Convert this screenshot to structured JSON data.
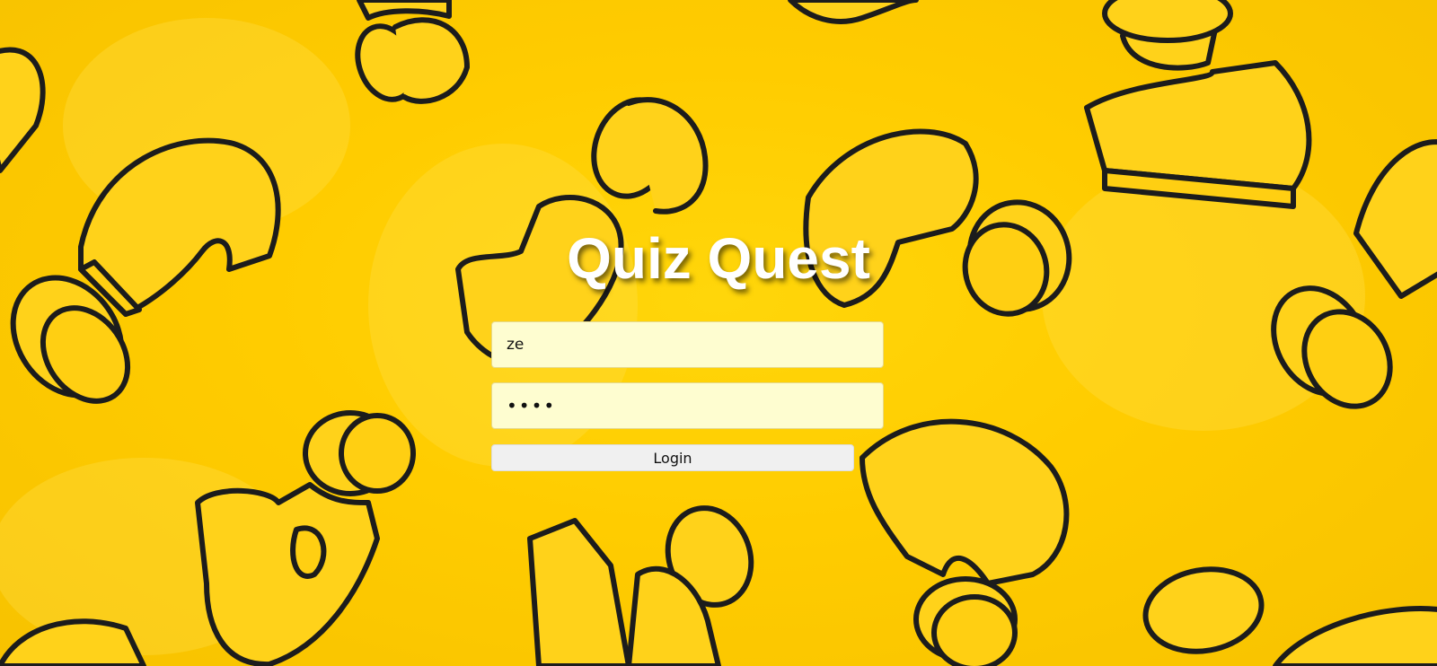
{
  "app": {
    "title": "Quiz Quest"
  },
  "form": {
    "username_value": "ze",
    "password_value": "abcd",
    "login_label": "Login"
  },
  "background": {
    "pattern": "question-mark-icon",
    "color": "#ffcc00",
    "outline_color": "#1c1c1c"
  },
  "colors": {
    "input_bg": "#fefdd0",
    "button_bg": "#f0f0f0",
    "title": "#ffffff"
  }
}
